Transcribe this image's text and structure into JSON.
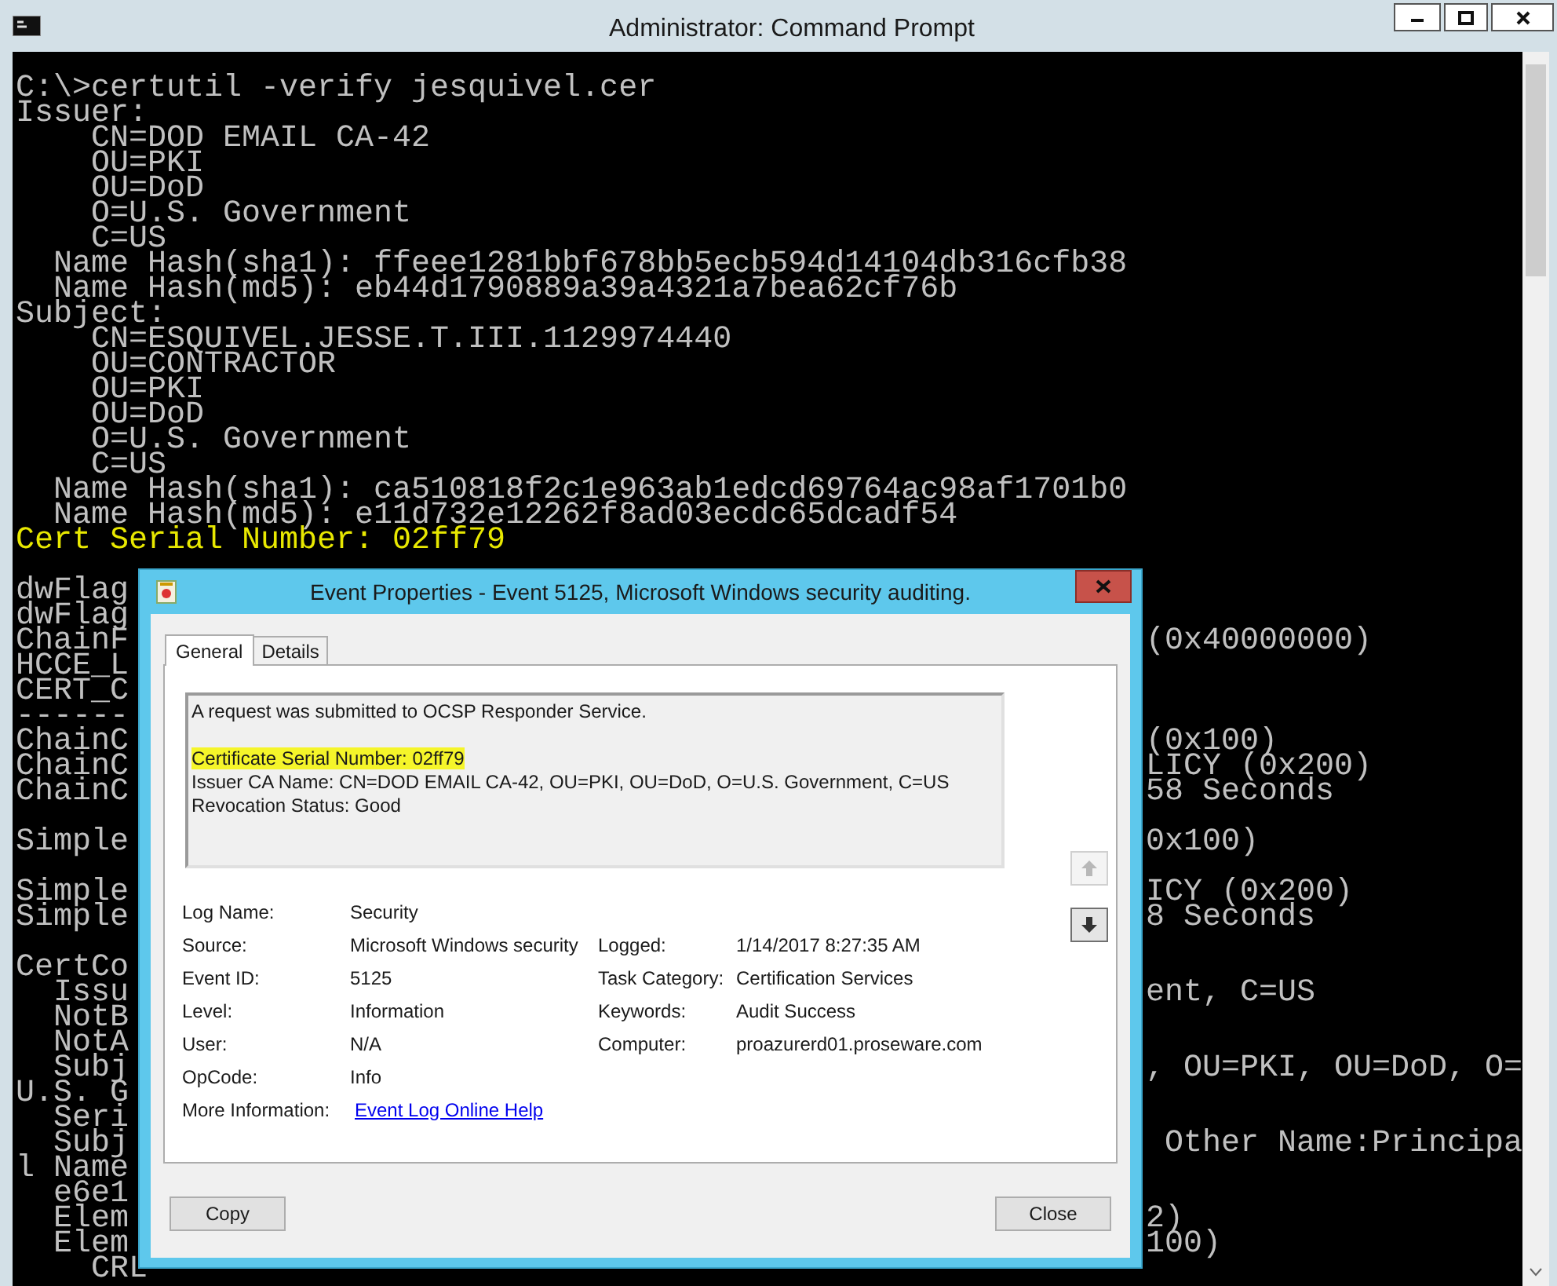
{
  "window": {
    "title": "Administrator: Command Prompt"
  },
  "console": {
    "lines": [
      {
        "kind": "full",
        "text": "C:\\>certutil -verify jesquivel.cer"
      },
      {
        "kind": "full",
        "text": "Issuer:"
      },
      {
        "kind": "full",
        "text": "    CN=DOD EMAIL CA-42"
      },
      {
        "kind": "full",
        "text": "    OU=PKI"
      },
      {
        "kind": "full",
        "text": "    OU=DoD"
      },
      {
        "kind": "full",
        "text": "    O=U.S. Government"
      },
      {
        "kind": "full",
        "text": "    C=US"
      },
      {
        "kind": "full",
        "text": "  Name Hash(sha1): ffeee1281bbf678bb5ecb594d14104db316cfb38"
      },
      {
        "kind": "full",
        "text": "  Name Hash(md5): eb44d1790889a39a4321a7bea62cf76b"
      },
      {
        "kind": "full",
        "text": "Subject:"
      },
      {
        "kind": "full",
        "text": "    CN=ESQUIVEL.JESSE.T.III.1129974440"
      },
      {
        "kind": "full",
        "text": "    OU=CONTRACTOR"
      },
      {
        "kind": "full",
        "text": "    OU=PKI"
      },
      {
        "kind": "full",
        "text": "    OU=DoD"
      },
      {
        "kind": "full",
        "text": "    O=U.S. Government"
      },
      {
        "kind": "full",
        "text": "    C=US"
      },
      {
        "kind": "full",
        "text": "  Name Hash(sha1): ca510818f2c1e963ab1edcd69764ac98af1701b0"
      },
      {
        "kind": "full",
        "text": "  Name Hash(md5): e11d732e12262f8ad03ecdc65dcadf54"
      },
      {
        "kind": "highlight",
        "text": "Cert Serial Number: 02ff79"
      },
      {
        "kind": "blank"
      },
      {
        "kind": "split",
        "left": "dwFlag"
      },
      {
        "kind": "split",
        "left": "dwFlag"
      },
      {
        "kind": "split",
        "left": "ChainF",
        "right": "(0x40000000)"
      },
      {
        "kind": "split",
        "left": "HCCE_L"
      },
      {
        "kind": "split",
        "left": "CERT_C"
      },
      {
        "kind": "split",
        "left": "------"
      },
      {
        "kind": "split",
        "left": "ChainC",
        "right": "(0x100)"
      },
      {
        "kind": "split",
        "left": "ChainC",
        "right": "LICY (0x200)"
      },
      {
        "kind": "split",
        "left": "ChainC",
        "right": "58 Seconds"
      },
      {
        "kind": "blank"
      },
      {
        "kind": "split",
        "left": "Simple",
        "right": "0x100)"
      },
      {
        "kind": "blank"
      },
      {
        "kind": "split",
        "left": "Simple",
        "right": "ICY (0x200)"
      },
      {
        "kind": "split",
        "left": "Simple",
        "right": "8 Seconds"
      },
      {
        "kind": "blank"
      },
      {
        "kind": "split",
        "left": "CertCo"
      },
      {
        "kind": "split",
        "left": "  Issu",
        "right": "ent, C=US"
      },
      {
        "kind": "split",
        "left": "  NotB"
      },
      {
        "kind": "split",
        "left": "  NotA"
      },
      {
        "kind": "split",
        "left": "  Subj",
        "right": ", OU=PKI, OU=DoD, O="
      },
      {
        "kind": "split",
        "left": "U.S. G"
      },
      {
        "kind": "split",
        "left": "  Seri"
      },
      {
        "kind": "split",
        "left": "  Subj",
        "right": " Other Name:Principa"
      },
      {
        "kind": "split",
        "left": "l Name"
      },
      {
        "kind": "split",
        "left": "  e6e1"
      },
      {
        "kind": "split",
        "left": "  Elem",
        "right": "2)"
      },
      {
        "kind": "split",
        "left": "  Elem",
        "right": "100)"
      },
      {
        "kind": "split",
        "left": "    CRL"
      }
    ]
  },
  "dialog": {
    "title": "Event Properties - Event 5125, Microsoft Windows security auditing.",
    "tabs": [
      {
        "label": "General",
        "selected": true
      },
      {
        "label": "Details",
        "selected": false
      }
    ],
    "paragraphs": [
      {
        "lines": [
          {
            "text": "A request was submitted to OCSP Responder Service.",
            "highlighted": false
          }
        ]
      },
      {
        "lines": [
          {
            "text": "Certificate Serial Number: 02ff79",
            "highlighted": true
          },
          {
            "text": "Issuer CA Name: CN=DOD EMAIL CA-42, OU=PKI, OU=DoD, O=U.S. Government, C=US",
            "highlighted": false
          },
          {
            "text": "Revocation Status: Good",
            "highlighted": false
          }
        ]
      }
    ],
    "scroll_buttons": [
      {
        "kind": "up",
        "disabled": true
      },
      {
        "kind": "down",
        "disabled": false
      }
    ],
    "rows": [
      {
        "left": {
          "label": "Log Name:",
          "value": "Security"
        }
      },
      {
        "left": {
          "label": "Source:",
          "value": "Microsoft Windows security"
        },
        "right": {
          "label": "Logged:",
          "value": "1/14/2017 8:27:35 AM"
        }
      },
      {
        "left": {
          "label": "Event ID:",
          "value": "5125"
        },
        "right": {
          "label": "Task Category:",
          "value": "Certification Services"
        }
      },
      {
        "left": {
          "label": "Level:",
          "value": "Information"
        },
        "right": {
          "label": "Keywords:",
          "value": "Audit Success"
        }
      },
      {
        "left": {
          "label": "User:",
          "value": "N/A"
        },
        "right": {
          "label": "Computer:",
          "value": "proazurerd01.proseware.com"
        }
      },
      {
        "left": {
          "label": "OpCode:",
          "value": "Info"
        }
      }
    ],
    "more_information": {
      "label": "More Information:",
      "link": "Event Log Online Help"
    },
    "buttons": [
      "Copy",
      "Close"
    ]
  }
}
